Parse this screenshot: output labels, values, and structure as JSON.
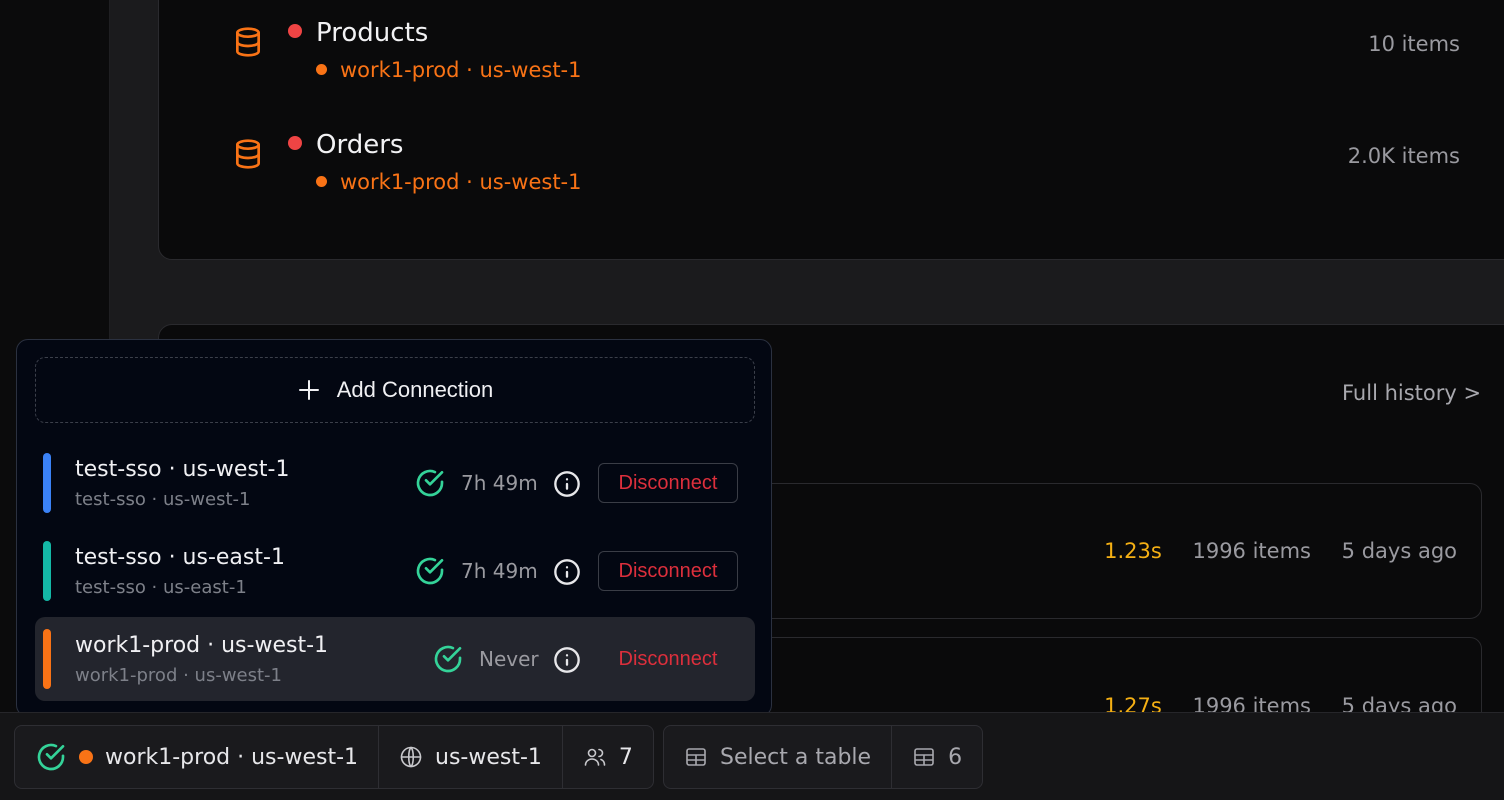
{
  "tables": [
    {
      "name": "Products",
      "connection": "work1-prod · us-west-1",
      "count": "10 items"
    },
    {
      "name": "Orders",
      "connection": "work1-prod · us-west-1",
      "count": "2.0K items"
    }
  ],
  "history": {
    "full_history_label": "Full history >",
    "rows": [
      {
        "duration": "1.23s",
        "items": "1996 items",
        "ago": "5 days ago"
      },
      {
        "duration": "1.27s",
        "items": "1996 items",
        "ago": "5 days ago"
      }
    ]
  },
  "popup": {
    "add_label": "Add Connection",
    "connections": [
      {
        "title": "test-sso · us-west-1",
        "subtitle": "test-sso · us-west-1",
        "time": "7h 49m",
        "disconnect": "Disconnect",
        "color": "#3b82f6",
        "active": false
      },
      {
        "title": "test-sso · us-east-1",
        "subtitle": "test-sso · us-east-1",
        "time": "7h 49m",
        "disconnect": "Disconnect",
        "color": "#14b8a6",
        "active": false
      },
      {
        "title": "work1-prod · us-west-1",
        "subtitle": "work1-prod · us-west-1",
        "time": "Never",
        "disconnect": "Disconnect",
        "color": "#f97316",
        "active": true
      }
    ]
  },
  "status_bar": {
    "connection": "work1-prod · us-west-1",
    "region": "us-west-1",
    "users_count": "7",
    "table_placeholder": "Select a table",
    "tables_count": "6"
  },
  "colors": {
    "accent_orange": "#f97316",
    "status_red": "#ef4444",
    "success_green": "#34d399",
    "danger": "#dc2f3c",
    "duration_amber": "#f5b014"
  }
}
